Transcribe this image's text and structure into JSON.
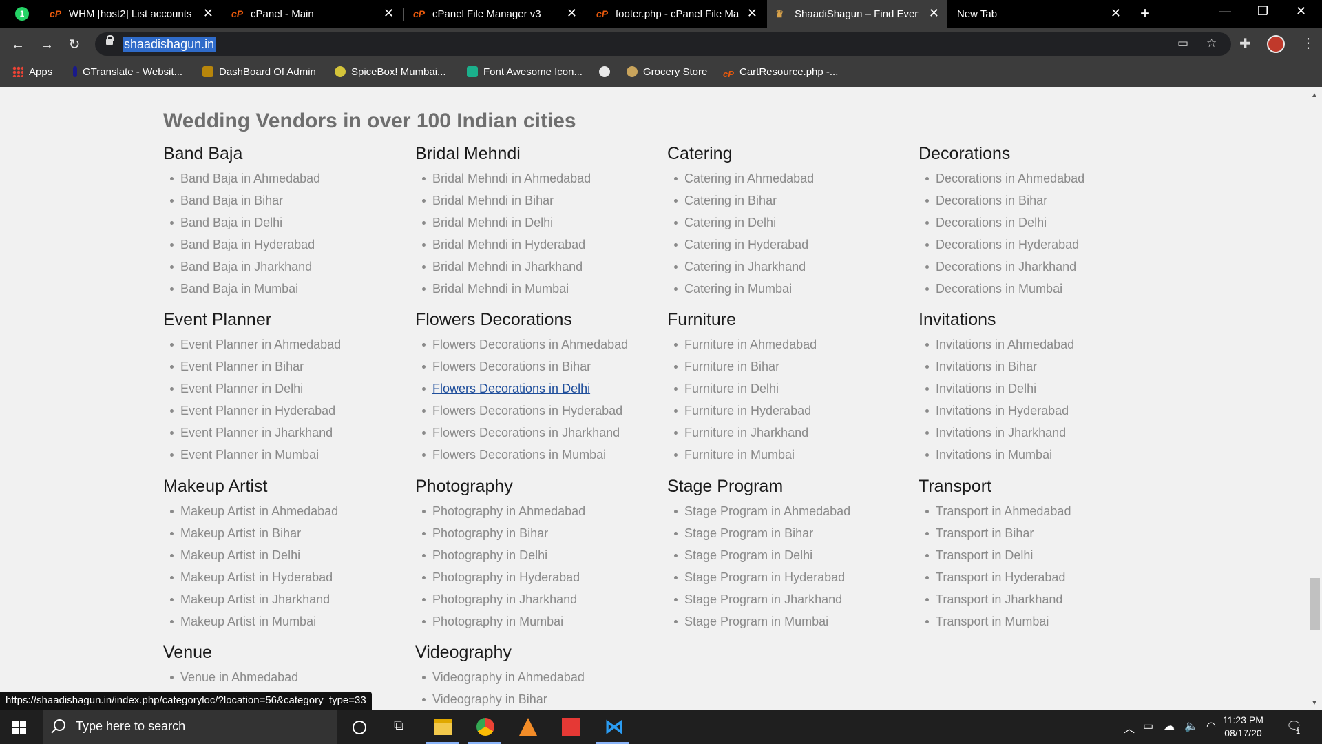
{
  "browser": {
    "tabs": [
      {
        "title": "WHM [host2] List accounts",
        "icon": "cpanel-icon",
        "active": false
      },
      {
        "title": "cPanel - Main",
        "icon": "cpanel-icon",
        "active": false
      },
      {
        "title": "cPanel File Manager v3",
        "icon": "cpanel-icon",
        "active": false
      },
      {
        "title": "footer.php - cPanel File Mar",
        "icon": "cpanel-icon",
        "active": false
      },
      {
        "title": "ShaadiShagun – Find Everyth",
        "icon": "shaadishagun-icon",
        "active": true
      },
      {
        "title": "New Tab",
        "icon": "",
        "active": false
      }
    ],
    "whatsapp_badge": "1",
    "url": "shaadishagun.in",
    "bookmarks": [
      {
        "label": "Apps",
        "icon": "apps-grid-icon"
      },
      {
        "label": "GTranslate - Websit...",
        "icon": "gtranslate-icon"
      },
      {
        "label": "DashBoard Of Admin",
        "icon": "dashboard-icon"
      },
      {
        "label": "SpiceBox! Mumbai...",
        "icon": "spicebox-icon"
      },
      {
        "label": "Font Awesome Icon...",
        "icon": "fontawesome-icon"
      },
      {
        "label": "",
        "icon": "globe-icon"
      },
      {
        "label": "Grocery Store",
        "icon": "grocery-icon"
      },
      {
        "label": "CartResource.php -...",
        "icon": "cpanel-icon"
      }
    ]
  },
  "page": {
    "heading": "Wedding Vendors in over 100 Indian cities",
    "categories": [
      {
        "name": "Band Baja",
        "links": [
          "Band Baja in Ahmedabad",
          "Band Baja in Bihar",
          "Band Baja in Delhi",
          "Band Baja in Hyderabad",
          "Band Baja in Jharkhand",
          "Band Baja in Mumbai"
        ]
      },
      {
        "name": "Bridal Mehndi",
        "links": [
          "Bridal Mehndi in Ahmedabad",
          "Bridal Mehndi in Bihar",
          "Bridal Mehndi in Delhi",
          "Bridal Mehndi in Hyderabad",
          "Bridal Mehndi in Jharkhand",
          "Bridal Mehndi in Mumbai"
        ]
      },
      {
        "name": "Catering",
        "links": [
          "Catering in Ahmedabad",
          "Catering in Bihar",
          "Catering in Delhi",
          "Catering in Hyderabad",
          "Catering in Jharkhand",
          "Catering in Mumbai"
        ]
      },
      {
        "name": "Decorations",
        "links": [
          "Decorations in Ahmedabad",
          "Decorations in Bihar",
          "Decorations in Delhi",
          "Decorations in Hyderabad",
          "Decorations in Jharkhand",
          "Decorations in Mumbai"
        ]
      },
      {
        "name": "Event Planner",
        "links": [
          "Event Planner in Ahmedabad",
          "Event Planner in Bihar",
          "Event Planner in Delhi",
          "Event Planner in Hyderabad",
          "Event Planner in Jharkhand",
          "Event Planner in Mumbai"
        ]
      },
      {
        "name": "Flowers Decorations",
        "links": [
          "Flowers Decorations in Ahmedabad",
          "Flowers Decorations in Bihar",
          "Flowers Decorations in Delhi",
          "Flowers Decorations in Hyderabad",
          "Flowers Decorations in Jharkhand",
          "Flowers Decorations in Mumbai"
        ]
      },
      {
        "name": "Furniture",
        "links": [
          "Furniture in Ahmedabad",
          "Furniture in Bihar",
          "Furniture in Delhi",
          "Furniture in Hyderabad",
          "Furniture in Jharkhand",
          "Furniture in Mumbai"
        ]
      },
      {
        "name": "Invitations",
        "links": [
          "Invitations in Ahmedabad",
          "Invitations in Bihar",
          "Invitations in Delhi",
          "Invitations in Hyderabad",
          "Invitations in Jharkhand",
          "Invitations in Mumbai"
        ]
      },
      {
        "name": "Makeup Artist",
        "links": [
          "Makeup Artist in Ahmedabad",
          "Makeup Artist in Bihar",
          "Makeup Artist in Delhi",
          "Makeup Artist in Hyderabad",
          "Makeup Artist in Jharkhand",
          "Makeup Artist in Mumbai"
        ]
      },
      {
        "name": "Photography",
        "links": [
          "Photography in Ahmedabad",
          "Photography in Bihar",
          "Photography in Delhi",
          "Photography in Hyderabad",
          "Photography in Jharkhand",
          "Photography in Mumbai"
        ]
      },
      {
        "name": "Stage Program",
        "links": [
          "Stage Program in Ahmedabad",
          "Stage Program in Bihar",
          "Stage Program in Delhi",
          "Stage Program in Hyderabad",
          "Stage Program in Jharkhand",
          "Stage Program in Mumbai"
        ]
      },
      {
        "name": "Transport",
        "links": [
          "Transport in Ahmedabad",
          "Transport in Bihar",
          "Transport in Delhi",
          "Transport in Hyderabad",
          "Transport in Jharkhand",
          "Transport in Mumbai"
        ]
      },
      {
        "name": "Venue",
        "links": [
          "Venue in Ahmedabad"
        ]
      },
      {
        "name": "Videography",
        "links": [
          "Videography in Ahmedabad",
          "Videography in Bihar"
        ]
      }
    ],
    "hovered_link": "Flowers Decorations in Delhi",
    "status_url": "https://shaadishagun.in/index.php/categoryloc/?location=56&category_type=33"
  },
  "taskbar": {
    "search_placeholder": "Type here to search",
    "time": "11:23 PM",
    "date": "08/17/20",
    "notification_count": "1"
  },
  "colors": {
    "accent": "#2f6bc9",
    "link": "#8a8a8a",
    "link_hover": "#1f4e9b"
  }
}
